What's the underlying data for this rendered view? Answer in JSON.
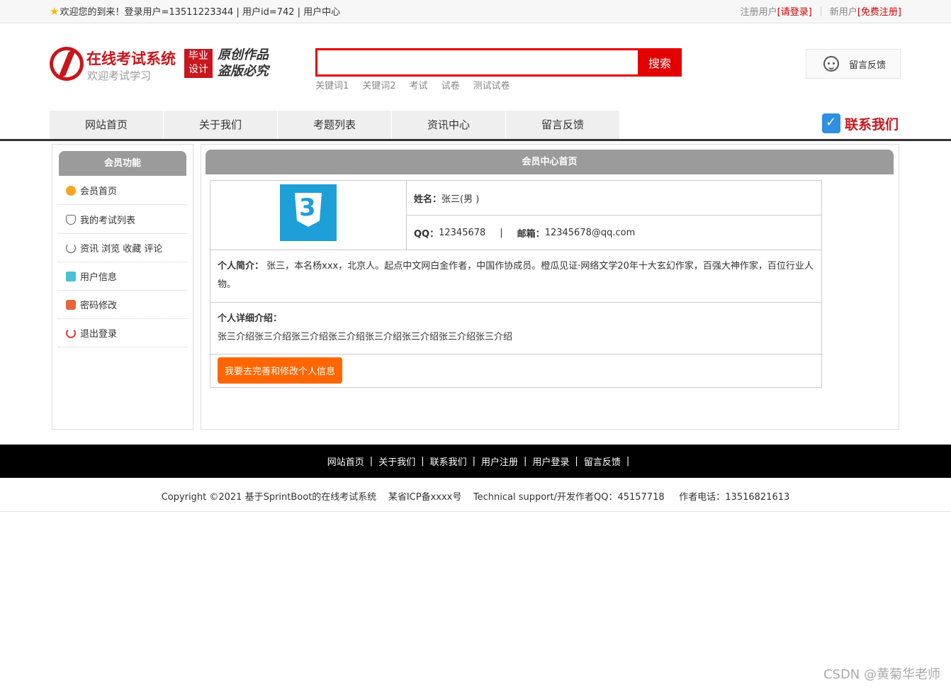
{
  "topbar": {
    "welcome": "欢迎您的到来！登录用户=13511223344 | 用户id=742 | 用户中心",
    "register_prefix": "注册用户",
    "login_link": "[请登录]",
    "new_prefix": "新用户",
    "free_register_link": "[免费注册]"
  },
  "logo": {
    "title": "在线考试系统",
    "subtitle": "欢迎考试学习",
    "badge_line1": "毕业",
    "badge_line2": "设计",
    "brush_line1": "原创作品",
    "brush_line2": "盗版必究"
  },
  "search": {
    "value": "",
    "button": "搜索",
    "keywords": [
      "关键词1",
      "关键词2",
      "考试",
      "试卷",
      "测试试卷"
    ]
  },
  "feedback_label": "留言反馈",
  "nav": [
    "网站首页",
    "关于我们",
    "考题列表",
    "资讯中心",
    "留言反馈"
  ],
  "contact_label": "联系我们",
  "sidebar": {
    "title": "会员功能",
    "items": [
      "会员首页",
      "我的考试列表",
      "资讯 浏览 收藏 评论",
      "用户信息",
      "密码修改",
      "退出登录"
    ]
  },
  "main": {
    "title": "会员中心首页",
    "name_label": "姓名：",
    "name_value": "张三(男 )",
    "qq_label": "QQ：",
    "qq_value": "12345678",
    "divider": "|",
    "email_label": "邮箱：",
    "email_value": "12345678@qq.com",
    "intro_label": "个人简介：",
    "intro_value": "张三，本名杨xxx，北京人。起点中文网白金作者，中国作协成员。橙瓜见证·网络文学20年十大玄幻作家，百强大神作家，百位行业人物。",
    "detail_label": "个人详细介绍：",
    "detail_value": "张三介绍张三介绍张三介绍张三介绍张三介绍张三介绍张三介绍张三介绍",
    "edit_button": "我要去完善和修改个人信息"
  },
  "footer": {
    "links": [
      "网站首页",
      "关于我们",
      "联系我们",
      "用户注册",
      "用户登录",
      "留言反馈"
    ],
    "separator": "|",
    "copyright": "Copyright ©2021 基于SprintBoot的在线考试系统    某省ICP备xxxx号    Technical support/开发作者QQ：45157718     作者电话：13516821613"
  },
  "watermark": "CSDN @黄菊华老师",
  "colors": {
    "brand_red": "#c8161d",
    "search_red": "#e30000",
    "header_gray": "#9b9b9b",
    "button_orange": "#ff6600"
  }
}
